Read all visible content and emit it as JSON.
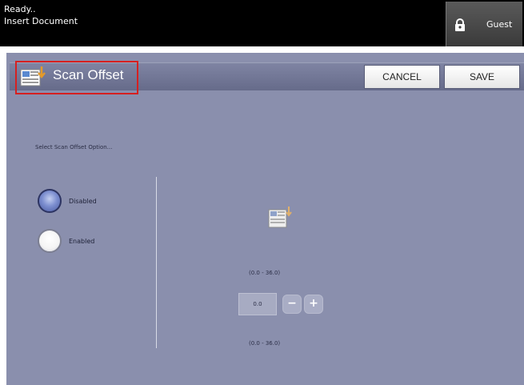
{
  "status": {
    "line1": "Ready..",
    "line2": "Insert Document"
  },
  "user": {
    "label": "Guest",
    "icon": "lock-icon"
  },
  "header": {
    "title": "Scan Offset",
    "icon": "scan-document-icon"
  },
  "toolbar": {
    "cancel_label": "CANCEL",
    "save_label": "SAVE"
  },
  "options": {
    "prompt": "Select Scan Offset Option...",
    "items": [
      {
        "label": "Disabled",
        "selected": true
      },
      {
        "label": "Enabled",
        "selected": false
      }
    ]
  },
  "offset": {
    "range_top": "(0.0 - 36.0)",
    "value": "0.0",
    "minus": "−",
    "plus": "+",
    "range_bottom": "(0.0 - 36.0)"
  },
  "colors": {
    "panel": "#8a8fad",
    "titlebar": "#6e7393",
    "highlight": "#d62020"
  }
}
